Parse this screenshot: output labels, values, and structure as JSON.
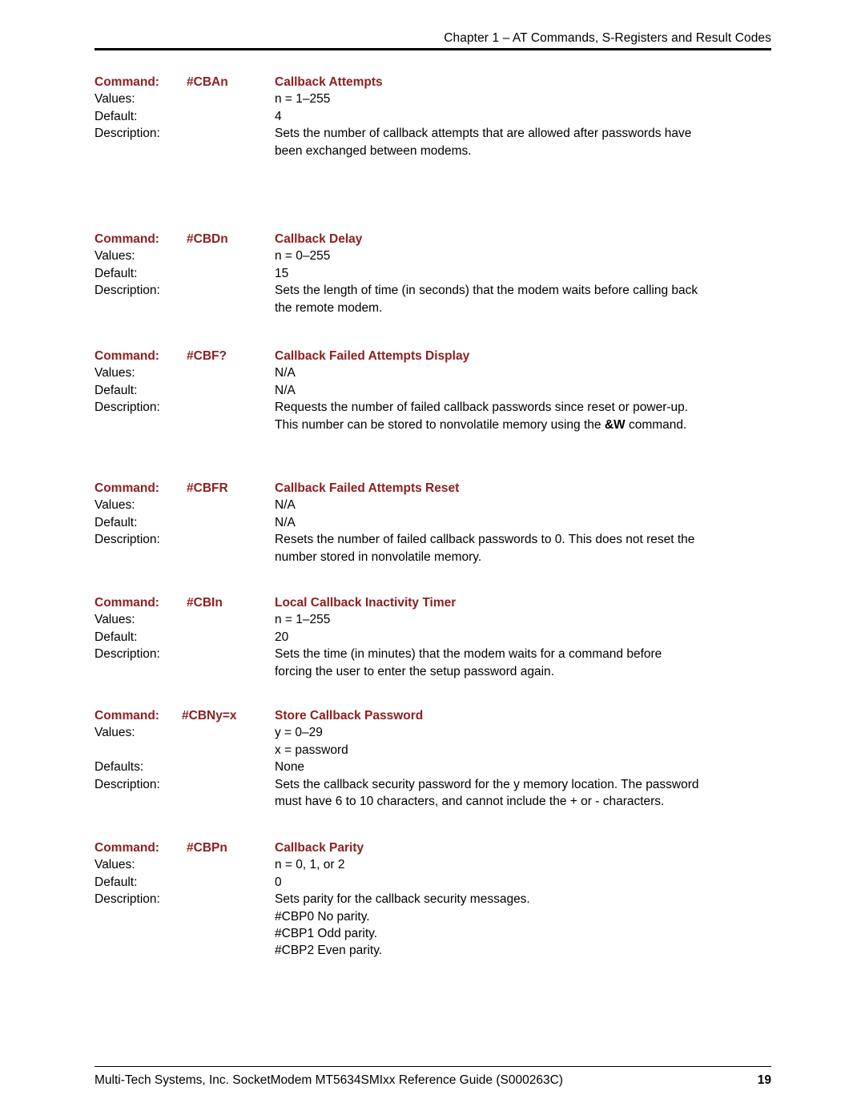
{
  "header": {
    "running_head": "Chapter 1 – AT Commands, S-Registers and Result Codes"
  },
  "labels": {
    "command": "Command:",
    "values": "Values:",
    "default": "Default:",
    "defaults": "Defaults:",
    "description": "Description:"
  },
  "colors": {
    "heading": "#8C2020",
    "text": "#000000",
    "background": "#FFFFFF"
  },
  "blocks": [
    {
      "label_command": "Command:",
      "code": "#CBAn",
      "title": "Callback Attempts",
      "label_values": "Values:",
      "values": [
        "n = 1–255"
      ],
      "label_default": "Default:",
      "default": "4",
      "label_description": "Description:",
      "description": [
        "Sets the number of callback attempts that are allowed after passwords have",
        "been exchanged between modems."
      ]
    },
    {
      "label_command": "Command:",
      "code": "#CBDn",
      "title": "Callback Delay",
      "label_values": "Values:",
      "values": [
        "n = 0–255"
      ],
      "label_default": "Default:",
      "default": "15",
      "label_description": "Description:",
      "description": [
        "Sets the length of time (in seconds) that the modem waits before calling back",
        "the remote modem."
      ]
    },
    {
      "label_command": "Command:",
      "code": "#CBF?",
      "title": "Callback Failed Attempts Display",
      "label_values": "Values:",
      "values": [
        "N/A"
      ],
      "label_default": "Default:",
      "default": "N/A",
      "label_description": "Description:",
      "description": [
        "Requests the number of failed callback passwords since reset or power-up.",
        "This number can be stored to nonvolatile memory using the <b>&amp;W</b> command."
      ]
    },
    {
      "label_command": "Command:",
      "code": "#CBFR",
      "title": "Callback Failed Attempts Reset",
      "label_values": "Values:",
      "values": [
        "N/A"
      ],
      "label_default": "Default:",
      "default": "N/A",
      "label_description": "Description:",
      "description": [
        "Resets the number of failed callback passwords to 0. This does not reset the",
        "number stored in nonvolatile memory."
      ]
    },
    {
      "label_command": "Command:",
      "code": "#CBIn",
      "title": "Local Callback Inactivity Timer",
      "label_values": "Values:",
      "values": [
        "n = 1–255"
      ],
      "label_default": "Default:",
      "default": "20",
      "label_description": "Description:",
      "description": [
        "Sets the time (in minutes) that the modem waits for a command before",
        "forcing the user to enter the setup password again."
      ]
    },
    {
      "label_command": "Command:",
      "code": "#CBNy=x",
      "title": "Store Callback Password",
      "label_values": "Values:",
      "values": [
        "y = 0–29",
        "x = password"
      ],
      "label_default": "Defaults:",
      "default": "None",
      "label_description": "Description:",
      "description": [
        "Sets the callback security password for the y memory location. The password",
        "must have 6 to 10 characters, and cannot include the + or - characters."
      ]
    },
    {
      "label_command": "Command:",
      "code": "#CBPn",
      "title": "Callback Parity",
      "label_values": "Values:",
      "values": [
        "n = 0, 1, or 2"
      ],
      "label_default": "Default:",
      "default": "0",
      "label_description": "Description:",
      "description": [
        "Sets parity for the callback security messages.",
        "#CBP0  No parity.",
        "#CBP1  Odd parity.",
        "#CBP2  Even parity."
      ]
    }
  ],
  "footer": {
    "text": "Multi-Tech Systems, Inc. SocketModem MT5634SMIxx Reference Guide (S000263C)",
    "page_number": "19"
  }
}
